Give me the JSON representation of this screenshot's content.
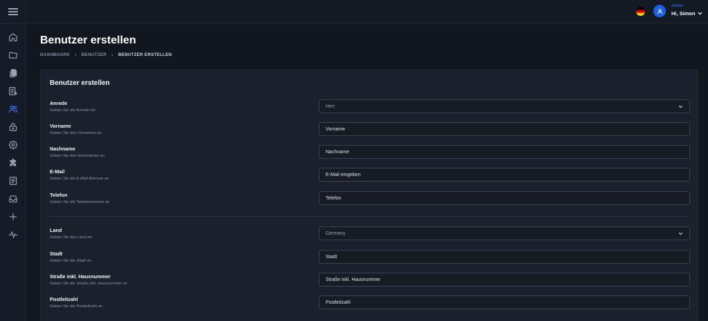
{
  "sidebar": {
    "items": [
      {
        "icon": "home-icon",
        "active": false
      },
      {
        "icon": "folder-icon",
        "active": false
      },
      {
        "icon": "documents-icon",
        "active": false
      },
      {
        "icon": "edit-list-icon",
        "active": false
      },
      {
        "icon": "users-icon",
        "active": true
      },
      {
        "icon": "lock-icon",
        "active": false
      },
      {
        "icon": "settings-icon",
        "active": false
      },
      {
        "icon": "puzzle-icon",
        "active": false
      },
      {
        "icon": "report-icon",
        "active": false
      },
      {
        "icon": "inbox-icon",
        "active": false
      },
      {
        "icon": "plus-icon",
        "active": false
      },
      {
        "icon": "activity-icon",
        "active": false
      }
    ]
  },
  "topbar": {
    "language": "de",
    "role": "Admin",
    "greeting": "Hi, Simon"
  },
  "page": {
    "title": "Benutzer erstellen",
    "breadcrumb": [
      "DASHBOARD",
      "BENUTZER",
      "BENUTZER ERSTELLEN"
    ]
  },
  "card": {
    "title": "Benutzer erstellen",
    "fields": [
      {
        "label": "Anrede",
        "hint": "Geben Sie die Anrede ein",
        "type": "select",
        "value": "Herr"
      },
      {
        "label": "Vorname",
        "hint": "Geben Sie den Vornamen an",
        "type": "input",
        "placeholder": "Vorname"
      },
      {
        "label": "Nachname",
        "hint": "Geben Sie den Nachnamen an",
        "type": "input",
        "placeholder": "Nachname"
      },
      {
        "label": "E-Mail",
        "hint": "Geben Sie die E-Mail Adresse an",
        "type": "input",
        "placeholder": "E-Mail eingeben"
      },
      {
        "label": "Telefon",
        "hint": "Geben Sie die Telefonnummer an",
        "type": "input",
        "placeholder": "Telefon"
      },
      {
        "label": "Land",
        "hint": "Geben Sie das Land an",
        "type": "select",
        "value": "Germany"
      },
      {
        "label": "Stadt",
        "hint": "Geben Sie die Stadt an",
        "type": "input",
        "placeholder": "Stadt"
      },
      {
        "label": "Straße inkl. Hausnummer",
        "hint": "Geben Sie die Straße inkl. Hausnummer an",
        "type": "input",
        "placeholder": "Straße inkl. Hausnummer"
      },
      {
        "label": "Postleitzahl",
        "hint": "Geben Sie die Postleitzahl an",
        "type": "input",
        "placeholder": "Postleitzahl"
      }
    ]
  },
  "colors": {
    "background": "#11161f",
    "card": "#1b212c",
    "accent": "#3a7bff",
    "icon": "#9aa3b4"
  }
}
